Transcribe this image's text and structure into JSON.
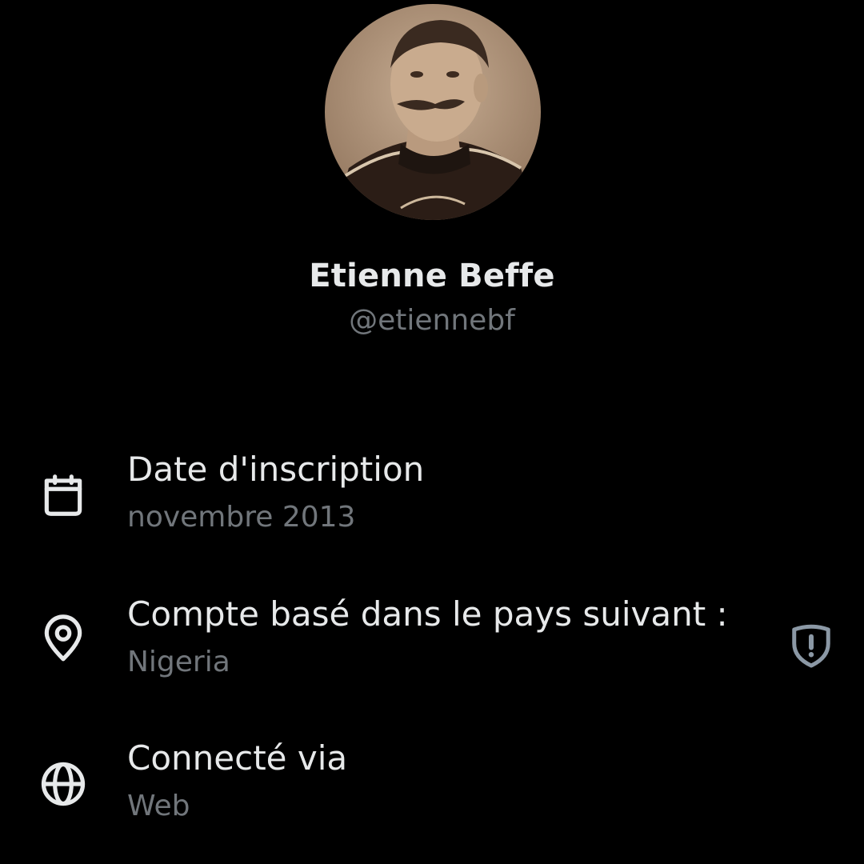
{
  "profile": {
    "name": "Etienne Beffe",
    "handle": "@etiennebf",
    "avatar_alt": "Sepia portrait photo"
  },
  "info": {
    "joined": {
      "icon": "calendar-icon",
      "title": "Date d'inscription",
      "value": "novembre 2013"
    },
    "country": {
      "icon": "location-pin-icon",
      "title": "Compte basé dans le pays suivant :",
      "value": "Nigeria",
      "badge_icon": "shield-alert-icon"
    },
    "connected": {
      "icon": "globe-icon",
      "title": "Connecté via",
      "value": "Web"
    }
  },
  "colors": {
    "background": "#000000",
    "primary_text": "#e7e9ea",
    "secondary_text": "#71767b",
    "shield": "#8b98a5"
  }
}
